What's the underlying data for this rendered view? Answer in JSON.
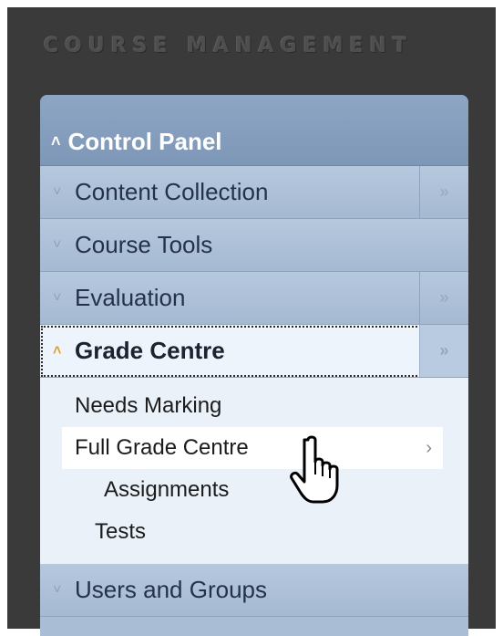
{
  "header": {
    "label": "COURSE MANAGEMENT"
  },
  "panel": {
    "title": "Control Panel",
    "items": [
      {
        "label": "Content Collection",
        "has_expand": true
      },
      {
        "label": "Course Tools",
        "has_expand": false
      },
      {
        "label": "Evaluation",
        "has_expand": true
      },
      {
        "label": "Grade Centre",
        "has_expand": true,
        "active": true
      }
    ],
    "grade_centre_sub": [
      {
        "label": "Needs Marking"
      },
      {
        "label": "Full Grade Centre"
      },
      {
        "label": "Assignments"
      },
      {
        "label": "Tests"
      }
    ],
    "after_items": [
      {
        "label": "Users and Groups"
      }
    ]
  },
  "icons": {
    "collapse": "double-chevron-up-icon",
    "expand": "double-chevron-right-icon",
    "cursor": "hand-pointer-icon"
  },
  "colors": {
    "frame": "#3a3a3a",
    "panel": "#a9bdd5",
    "active_chevron": "#e0a030"
  }
}
